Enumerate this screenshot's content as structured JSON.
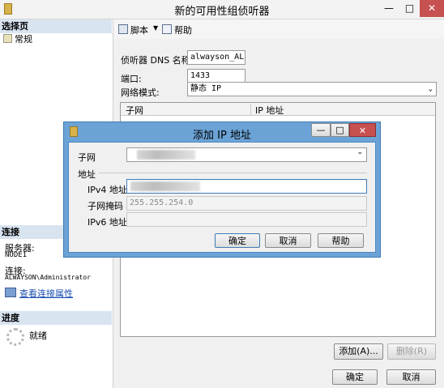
{
  "window": {
    "title": "新的可用性组侦听器",
    "minimize": "—",
    "maximize": "□",
    "close": "✕"
  },
  "left": {
    "select_page": "选择页",
    "pages": [
      "常规"
    ],
    "connection_header": "连接",
    "server_label": "服务器:",
    "server_value": "NODE1",
    "connection_label": "连接:",
    "connection_value": "ALWAYSON\\Administrator",
    "view_props_link": "查看连接属性",
    "progress_header": "进度",
    "progress_status": "就绪"
  },
  "toolbar": {
    "script": "脚本",
    "help": "帮助"
  },
  "form": {
    "dns_label": "侦听器 DNS 名称:",
    "dns_value": "alwayson_AL",
    "port_label": "端口:",
    "port_value": "1433",
    "mode_label": "网络模式:",
    "mode_value": "静态 IP"
  },
  "grid": {
    "columns": [
      "子网",
      "IP 地址"
    ]
  },
  "dialog": {
    "title": "添加 IP 地址",
    "subnet_label": "子网",
    "address_group": "地址",
    "ipv4_label": "IPv4 地址",
    "mask_label": "子网掩码",
    "mask_value": "255.255.254.0",
    "ipv6_label": "IPv6 地址",
    "ok": "确定",
    "cancel": "取消",
    "help": "帮助"
  },
  "buttons": {
    "add": "添加(A)...",
    "remove": "删除(R)",
    "ok": "确定",
    "cancel": "取消"
  },
  "colors": {
    "accent": "#3f7bb5",
    "dialog_frame": "#6ba3d6",
    "close_red": "#c75050",
    "link": "#1a4fb0"
  }
}
